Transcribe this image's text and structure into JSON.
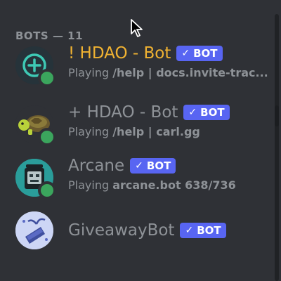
{
  "section": {
    "header": "BOTS — 11"
  },
  "bot_tag": {
    "check": "✓",
    "label": "BOT"
  },
  "colors": {
    "background": "#2f3136",
    "muted_text": "#8e9297",
    "highlight_name": "#f0b232",
    "bot_tag": "#5865f2",
    "online": "#3ba55d"
  },
  "members": [
    {
      "name": "! HDAO - Bot",
      "name_color": "#f0b232",
      "activity_prefix": "Playing ",
      "activity_value": "/help | docs.invite-trac...",
      "status": "online",
      "avatar_icon": "plus-circle-icon"
    },
    {
      "name": "+ HDAO - Bot",
      "name_color": "#8e9297",
      "activity_prefix": "Playing ",
      "activity_value": "/help | carl.gg",
      "status": "online",
      "avatar_icon": "turtle-icon"
    },
    {
      "name": "Arcane",
      "name_color": "#8e9297",
      "activity_prefix": "Playing ",
      "activity_value": "arcane.bot 638/736",
      "status": "online",
      "avatar_icon": "robot-icon"
    },
    {
      "name": "GiveawayBot",
      "name_color": "#8e9297",
      "activity_prefix": "",
      "activity_value": "",
      "status": "none",
      "avatar_icon": "gift-icon"
    }
  ]
}
